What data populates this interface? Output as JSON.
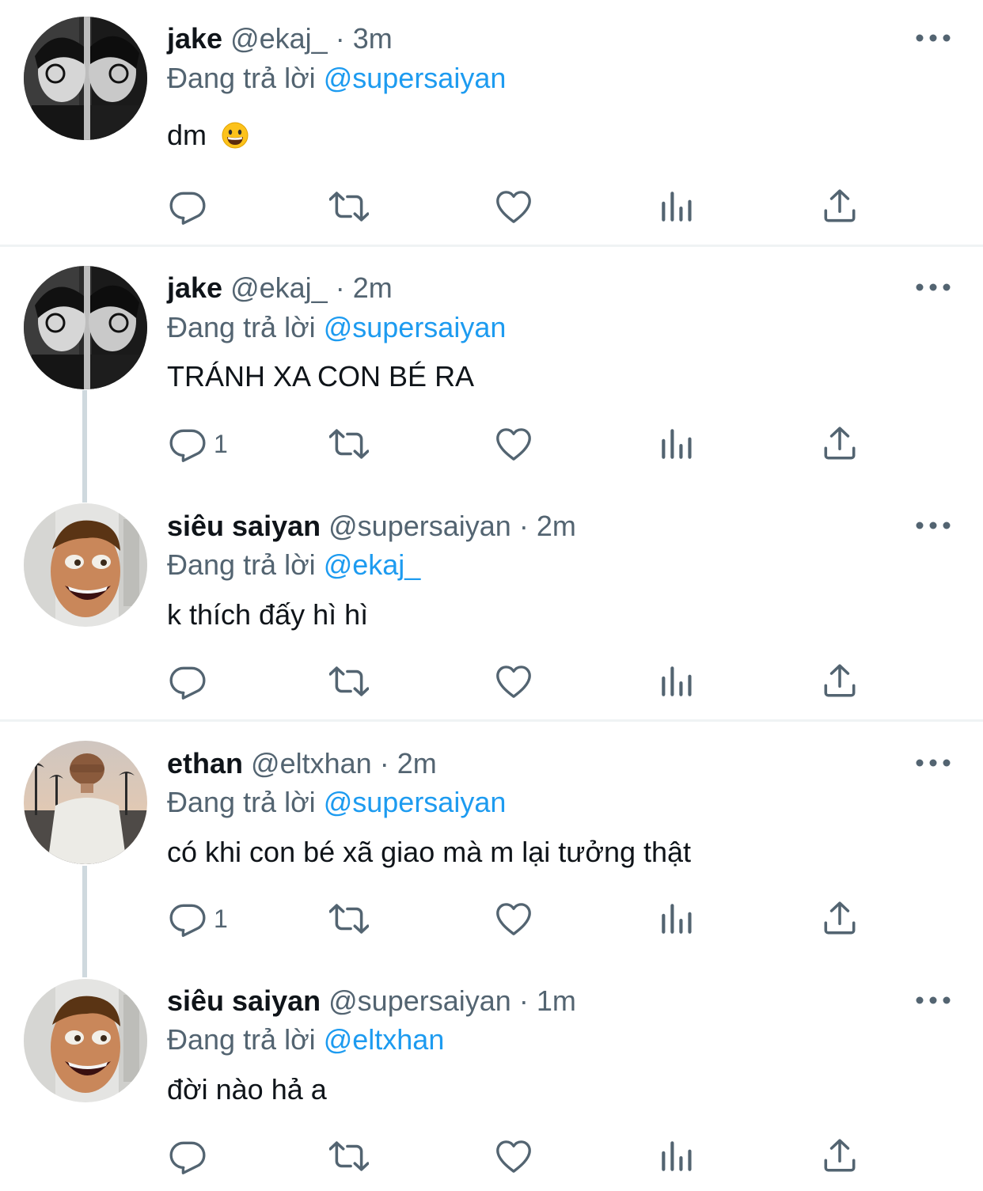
{
  "tweets": [
    {
      "name": "jake",
      "handle": "@ekaj_",
      "dot": "·",
      "time": "3m",
      "reply_prefix": "Đang trả lời",
      "reply_to": "@supersaiyan",
      "text": "dm",
      "emoji": "grinning-face",
      "reply_count": ""
    },
    {
      "name": "jake",
      "handle": "@ekaj_",
      "dot": "·",
      "time": "2m",
      "reply_prefix": "Đang trả lời",
      "reply_to": "@supersaiyan",
      "text": "TRÁNH XA CON BÉ RA",
      "reply_count": "1"
    },
    {
      "name": "siêu saiyan",
      "handle": "@supersaiyan",
      "dot": "·",
      "time": "2m",
      "reply_prefix": "Đang trả lời",
      "reply_to": "@ekaj_",
      "text": "k thích đấy hì hì",
      "reply_count": ""
    },
    {
      "name": "ethan",
      "handle": "@eltxhan",
      "dot": "·",
      "time": "2m",
      "reply_prefix": "Đang trả lời",
      "reply_to": "@supersaiyan",
      "text": "có khi con bé xã giao mà m lại tưởng thật",
      "reply_count": "1"
    },
    {
      "name": "siêu saiyan",
      "handle": "@supersaiyan",
      "dot": "·",
      "time": "1m",
      "reply_prefix": "Đang trả lời",
      "reply_to": "@eltxhan",
      "text": "đời nào hả a",
      "reply_count": ""
    }
  ],
  "colors": {
    "text_primary": "#0f1419",
    "text_secondary": "#536471",
    "mention": "#1d9bf0",
    "icon": "#536471",
    "divider": "#eff3f4",
    "thread_line": "#cfd9de"
  },
  "icons": [
    "reply-icon",
    "retweet-icon",
    "like-icon",
    "views-icon",
    "share-icon",
    "more-icon"
  ]
}
